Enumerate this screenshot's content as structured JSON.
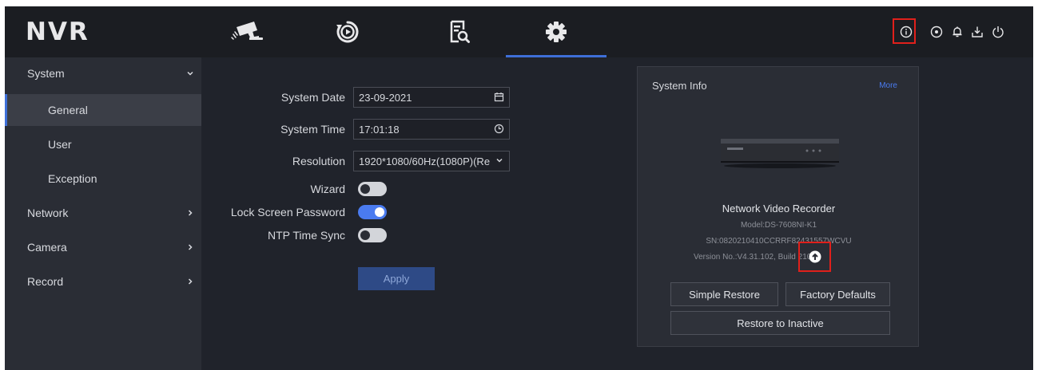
{
  "app": {
    "logo": "NVR"
  },
  "top_nav": {
    "tabs": [
      {
        "icon": "camera-icon",
        "active": false
      },
      {
        "icon": "playback-icon",
        "active": false
      },
      {
        "icon": "search-files-icon",
        "active": false
      },
      {
        "icon": "settings-gear-icon",
        "active": true
      }
    ],
    "right_icons": [
      "info-icon",
      "target-icon",
      "bell-icon",
      "download-icon",
      "power-icon"
    ]
  },
  "sidebar": {
    "items": [
      {
        "label": "System",
        "expanded": true
      },
      {
        "label": "General",
        "active": true
      },
      {
        "label": "User"
      },
      {
        "label": "Exception"
      },
      {
        "label": "Network"
      },
      {
        "label": "Camera"
      },
      {
        "label": "Record"
      }
    ]
  },
  "form": {
    "system_date_label": "System Date",
    "system_date_value": "23-09-2021",
    "system_time_label": "System Time",
    "system_time_value": "17:01:18",
    "resolution_label": "Resolution",
    "resolution_value": "1920*1080/60Hz(1080P)(Re",
    "wizard_label": "Wizard",
    "wizard_on": false,
    "lock_screen_label": "Lock Screen Password",
    "lock_screen_on": true,
    "ntp_label": "NTP Time Sync",
    "ntp_on": false,
    "apply_label": "Apply"
  },
  "system_info": {
    "title": "System Info",
    "more": "More",
    "device_name": "Network Video Recorder",
    "model": "Model:DS-7608NI-K1",
    "serial": "SN:0820210410CCRRF82431557WCVU",
    "version": "Version No.:V4.31.102, Build 21062",
    "simple_restore": "Simple Restore",
    "factory_defaults": "Factory Defaults",
    "restore_inactive": "Restore to Inactive"
  },
  "colors": {
    "accent": "#3e6fd8",
    "highlight_box": "#e0201b",
    "background": "#20232b"
  }
}
